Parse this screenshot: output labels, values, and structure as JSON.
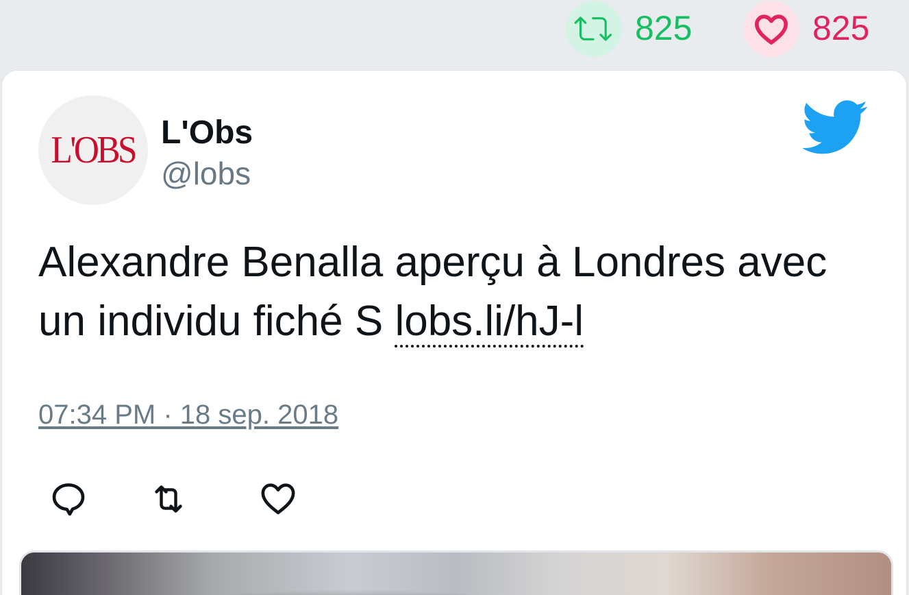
{
  "stats": {
    "retweet_count": "825",
    "like_count": "825",
    "retweet_color": "#17bf63",
    "like_color": "#e0245e"
  },
  "tweet": {
    "avatar_text": "L'OBS",
    "display_name": "L'Obs",
    "handle": "@lobs",
    "text": "Alexandre Benalla aperçu à Londres avec un individu fiché S ",
    "link_text": "lobs.li/hJ-l",
    "timestamp": "07:34 PM · 18 sep. 2018"
  },
  "icons": {
    "brand": "twitter-bird-icon",
    "actions": [
      "reply-icon",
      "retweet-icon",
      "like-icon"
    ]
  },
  "colors": {
    "twitter_blue": "#1da1f2",
    "text": "#0f1419",
    "muted": "#687885"
  }
}
